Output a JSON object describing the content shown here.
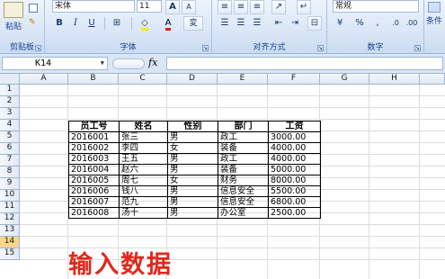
{
  "ribbon": {
    "clipboard": {
      "paste_label": "粘贴",
      "group_label": "剪贴板"
    },
    "font": {
      "name": "宋体",
      "size": "11",
      "group_label": "字体",
      "bold": "B",
      "italic": "I",
      "underline": "U",
      "grow": "A",
      "shrink": "A",
      "phonetic": "変"
    },
    "alignment": {
      "group_label": "对齐方式"
    },
    "number": {
      "format": "常规",
      "percent": "%",
      "comma": ",",
      "group_label": "数字"
    },
    "styles": {
      "label": "条件"
    }
  },
  "formula_bar": {
    "name_box": "K14",
    "fx": "fx",
    "formula": ""
  },
  "columns": [
    "A",
    "B",
    "C",
    "D",
    "E",
    "F",
    "G",
    "H"
  ],
  "rows": [
    "1",
    "2",
    "3",
    "4",
    "5",
    "6",
    "7",
    "8",
    "9",
    "10",
    "11",
    "12",
    "13",
    "14",
    "15"
  ],
  "active_row": "14",
  "table": {
    "headers": [
      "员工号",
      "姓名",
      "性别",
      "部门",
      "工资"
    ],
    "rows": [
      [
        "2016001",
        "张三",
        "男",
        "政工",
        "3000.00"
      ],
      [
        "2016002",
        "李四",
        "女",
        "装备",
        "4000.00"
      ],
      [
        "2016003",
        "王五",
        "男",
        "政工",
        "4000.00"
      ],
      [
        "2016004",
        "赵六",
        "男",
        "装备",
        "5000.00"
      ],
      [
        "2016005",
        "周七",
        "女",
        "财务",
        "8000.00"
      ],
      [
        "2016006",
        "钱八",
        "男",
        "信息安全",
        "5500.00"
      ],
      [
        "2016007",
        "范九",
        "男",
        "信息安全",
        "6800.00"
      ],
      [
        "2016008",
        "汤十",
        "男",
        "办公室",
        "2500.00"
      ]
    ]
  },
  "caption": "输入数据",
  "colors": {
    "caption": "#e0281d",
    "ribbon_text": "#15428b"
  }
}
